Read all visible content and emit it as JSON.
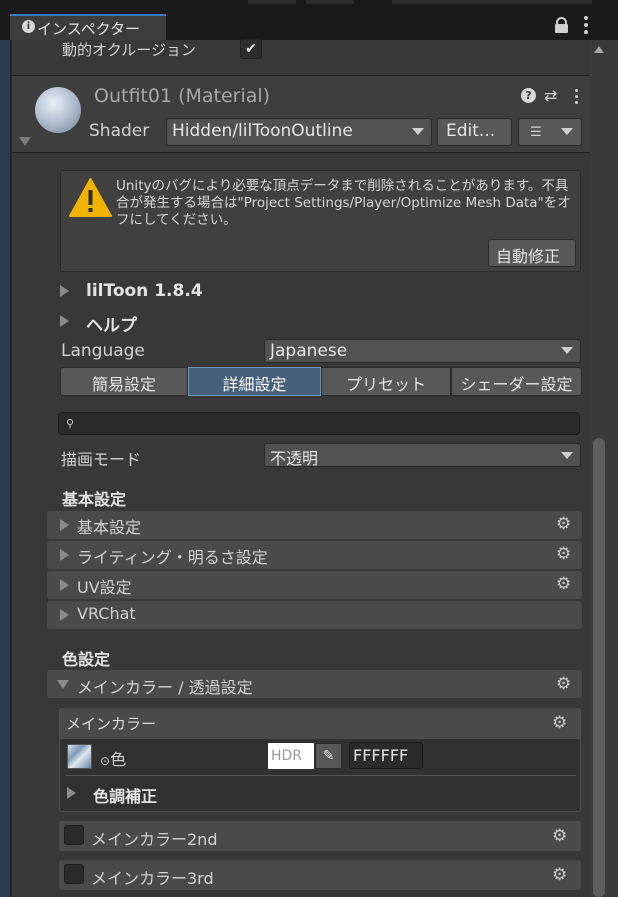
{
  "tab": {
    "title": "インスペクター",
    "info_icon": "info-icon",
    "lock_icon": "lock-icon",
    "menu_icon": "kebab-icon"
  },
  "occlusion": {
    "label": "動的オクルージョン",
    "checked": true
  },
  "material": {
    "name": "Outfit01 (Material)",
    "shader_label": "Shader",
    "shader_value": "Hidden/lilToonOutline",
    "edit_label": "Edit...",
    "help_icon": "help-icon",
    "preset_icon": "preset-icon",
    "menu_icon": "kebab-icon"
  },
  "warning": {
    "text": "Unityのバグにより必要な頂点データまで削除されることがあります。不具合が発生する場合は\"Project Settings/Player/Optimize Mesh Data\"をオフにしてください。",
    "button": "自動修正"
  },
  "foldouts": {
    "liltoon": "lilToon 1.8.4",
    "help": "ヘルプ"
  },
  "language": {
    "label": "Language",
    "value": "Japanese"
  },
  "modes": [
    "簡易設定",
    "詳細設定",
    "プリセット",
    "シェーダー設定"
  ],
  "active_mode": 1,
  "search": {
    "placeholder": ""
  },
  "render_mode": {
    "label": "描画モード",
    "value": "不透明"
  },
  "basic": {
    "header": "基本設定",
    "items": [
      "基本設定",
      "ライティング・明るさ設定",
      "UV設定",
      "VRChat"
    ]
  },
  "color": {
    "header": "色設定",
    "section": "メインカラー / 透過設定",
    "box_title": "メインカラー",
    "color_label": "色",
    "hdr": "HDR",
    "hex": "FFFFFF",
    "tone": "色調補正",
    "second": "メインカラー2nd",
    "third": "メインカラー3rd"
  },
  "colors": {
    "accent": "#3a79bb",
    "selected_mode": "#46607c",
    "warning": "#f0b400"
  }
}
